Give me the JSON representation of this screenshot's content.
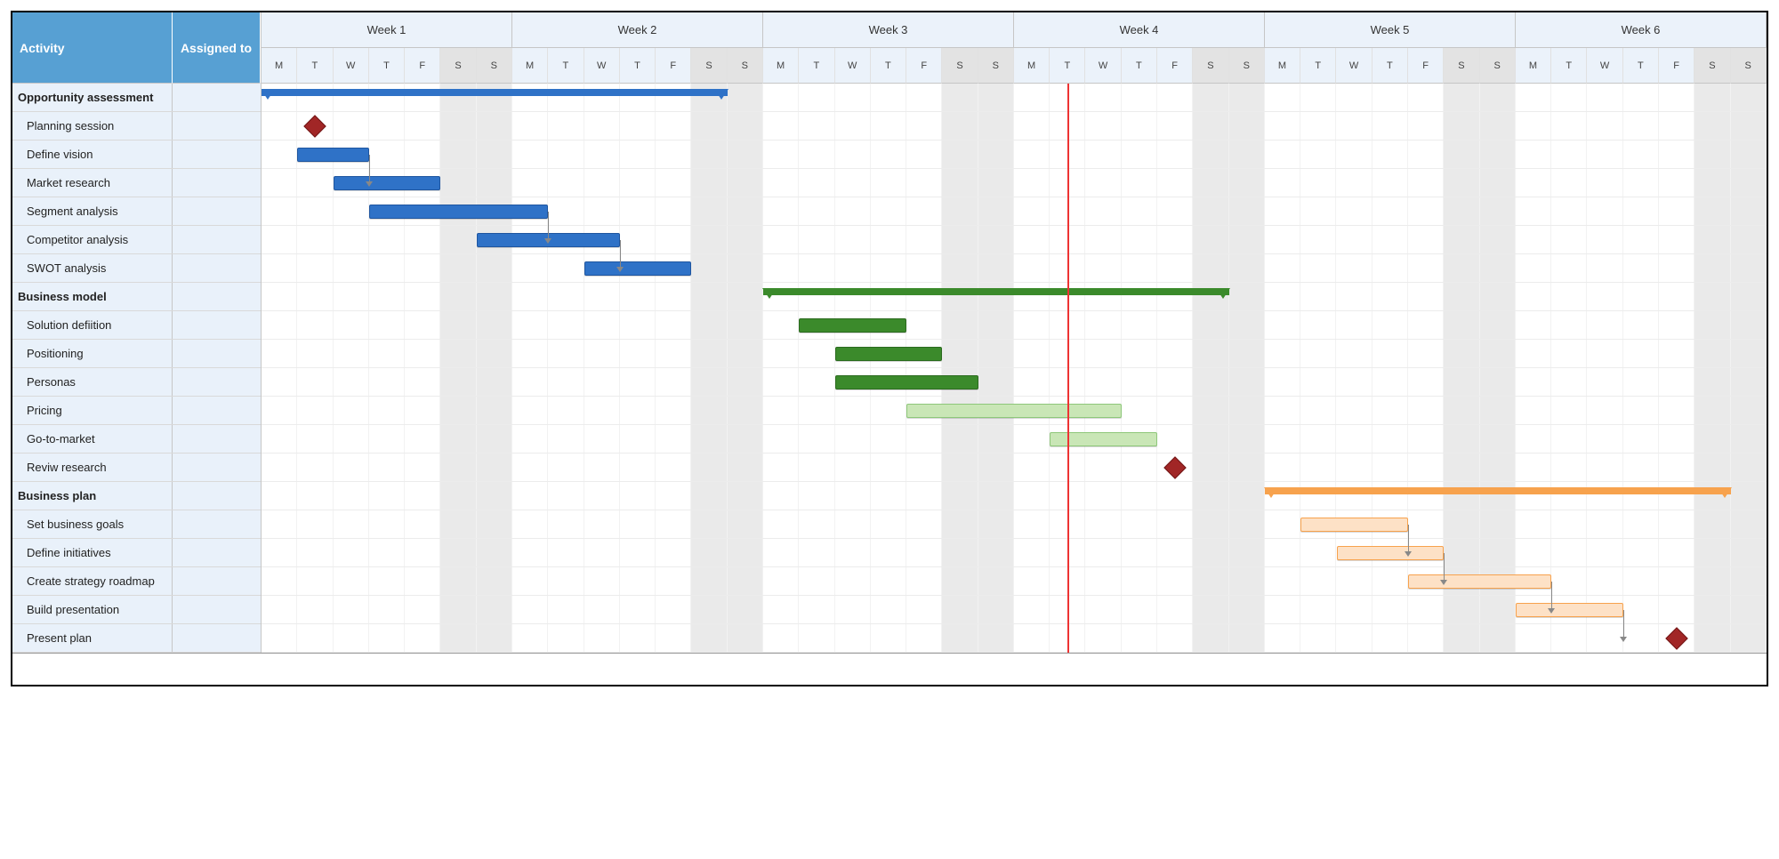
{
  "columns": {
    "activity": "Activity",
    "assigned": "Assigned to"
  },
  "weeks": [
    "Week 1",
    "Week 2",
    "Week 3",
    "Week 4",
    "Week 5",
    "Week 6"
  ],
  "day_letters": [
    "M",
    "T",
    "W",
    "T",
    "F",
    "S",
    "S"
  ],
  "today_day": 23,
  "total_days": 42,
  "rows": [
    {
      "type": "group",
      "label": "Opportunity assessment",
      "color": "blue",
      "start": 1,
      "end": 13
    },
    {
      "type": "milestone",
      "label": "Planning session",
      "day": 2,
      "color": "red"
    },
    {
      "type": "task",
      "label": "Define vision",
      "color": "blue",
      "start": 2,
      "end": 3
    },
    {
      "type": "task",
      "label": "Market research",
      "color": "blue",
      "start": 3,
      "end": 5
    },
    {
      "type": "task",
      "label": "Segment analysis",
      "color": "blue",
      "start": 4,
      "end": 8
    },
    {
      "type": "task",
      "label": "Competitor analysis",
      "color": "blue",
      "start": 7,
      "end": 10
    },
    {
      "type": "task",
      "label": "SWOT analysis",
      "color": "blue",
      "start": 10,
      "end": 12
    },
    {
      "type": "group",
      "label": "Business model",
      "color": "green",
      "start": 15,
      "end": 27
    },
    {
      "type": "task",
      "label": "Solution defiition",
      "color": "green",
      "start": 16,
      "end": 18
    },
    {
      "type": "task",
      "label": "Positioning",
      "color": "green",
      "start": 17,
      "end": 19
    },
    {
      "type": "task",
      "label": "Personas",
      "color": "green",
      "start": 17,
      "end": 20
    },
    {
      "type": "task",
      "label": "Pricing",
      "color": "lightgreen",
      "start": 19,
      "end": 24
    },
    {
      "type": "task",
      "label": "Go-to-market",
      "color": "lightgreen",
      "start": 23,
      "end": 25
    },
    {
      "type": "milestone",
      "label": "Reviw research",
      "day": 26,
      "color": "red"
    },
    {
      "type": "group",
      "label": "Business plan",
      "color": "orange",
      "start": 29,
      "end": 41
    },
    {
      "type": "task",
      "label": "Set business goals",
      "color": "orange",
      "start": 30,
      "end": 32
    },
    {
      "type": "task",
      "label": "Define initiatives",
      "color": "orange",
      "start": 31,
      "end": 33
    },
    {
      "type": "task",
      "label": "Create strategy roadmap",
      "color": "orange",
      "start": 33,
      "end": 36
    },
    {
      "type": "task",
      "label": "Build presentation",
      "color": "orange",
      "start": 36,
      "end": 38
    },
    {
      "type": "milestone",
      "label": "Present plan",
      "day": 40,
      "color": "red"
    }
  ],
  "dependencies": [
    {
      "from_row": 2,
      "to_row": 3,
      "from_day": 3,
      "to_day": 3
    },
    {
      "from_row": 4,
      "to_row": 5,
      "from_day": 8,
      "to_day": 11
    },
    {
      "from_row": 5,
      "to_row": 6,
      "from_day": 10,
      "to_day": 11
    },
    {
      "from_row": 15,
      "to_row": 16,
      "from_day": 32,
      "to_day": 33
    },
    {
      "from_row": 16,
      "to_row": 17,
      "from_day": 33,
      "to_day": 34
    },
    {
      "from_row": 17,
      "to_row": 18,
      "from_day": 36,
      "to_day": 37
    },
    {
      "from_row": 18,
      "to_row": 19,
      "from_day": 38,
      "to_day": 40
    }
  ],
  "colors": {
    "blue": "#2f72c7",
    "green": "#3b8a2b",
    "lightgreen": "#c9e6b6",
    "orange": "#f7a24d",
    "red": "#a12626",
    "header_bg": "#57a0d3",
    "row_bg": "#e9f1fa"
  },
  "chart_data": {
    "type": "gantt",
    "time_axis": {
      "unit": "day",
      "total": 42,
      "weeks": 6,
      "days_per_week": 7,
      "day_letters": [
        "M",
        "T",
        "W",
        "T",
        "F",
        "S",
        "S"
      ]
    },
    "today": 23,
    "groups": [
      {
        "name": "Opportunity assessment",
        "start": 1,
        "end": 13,
        "color": "#2f72c7",
        "tasks": [
          {
            "name": "Planning session",
            "type": "milestone",
            "day": 2
          },
          {
            "name": "Define vision",
            "start": 2,
            "end": 3
          },
          {
            "name": "Market research",
            "start": 3,
            "end": 5
          },
          {
            "name": "Segment analysis",
            "start": 4,
            "end": 8
          },
          {
            "name": "Competitor analysis",
            "start": 7,
            "end": 10
          },
          {
            "name": "SWOT analysis",
            "start": 10,
            "end": 12
          }
        ]
      },
      {
        "name": "Business model",
        "start": 15,
        "end": 27,
        "color": "#3b8a2b",
        "tasks": [
          {
            "name": "Solution defiition",
            "start": 16,
            "end": 18
          },
          {
            "name": "Positioning",
            "start": 17,
            "end": 19
          },
          {
            "name": "Personas",
            "start": 17,
            "end": 20
          },
          {
            "name": "Pricing",
            "start": 19,
            "end": 24,
            "fill": "light"
          },
          {
            "name": "Go-to-market",
            "start": 23,
            "end": 25,
            "fill": "light"
          },
          {
            "name": "Reviw research",
            "type": "milestone",
            "day": 26
          }
        ]
      },
      {
        "name": "Business plan",
        "start": 29,
        "end": 41,
        "color": "#f7a24d",
        "tasks": [
          {
            "name": "Set business goals",
            "start": 30,
            "end": 32
          },
          {
            "name": "Define initiatives",
            "start": 31,
            "end": 33
          },
          {
            "name": "Create strategy roadmap",
            "start": 33,
            "end": 36
          },
          {
            "name": "Build presentation",
            "start": 36,
            "end": 38
          },
          {
            "name": "Present plan",
            "type": "milestone",
            "day": 40
          }
        ]
      }
    ],
    "dependencies": [
      [
        "Define vision",
        "Market research"
      ],
      [
        "Segment analysis",
        "Competitor analysis"
      ],
      [
        "Competitor analysis",
        "SWOT analysis"
      ],
      [
        "Set business goals",
        "Define initiatives"
      ],
      [
        "Define initiatives",
        "Create strategy roadmap"
      ],
      [
        "Create strategy roadmap",
        "Build presentation"
      ],
      [
        "Build presentation",
        "Present plan"
      ]
    ],
    "columns": [
      "Activity",
      "Assigned to"
    ]
  }
}
